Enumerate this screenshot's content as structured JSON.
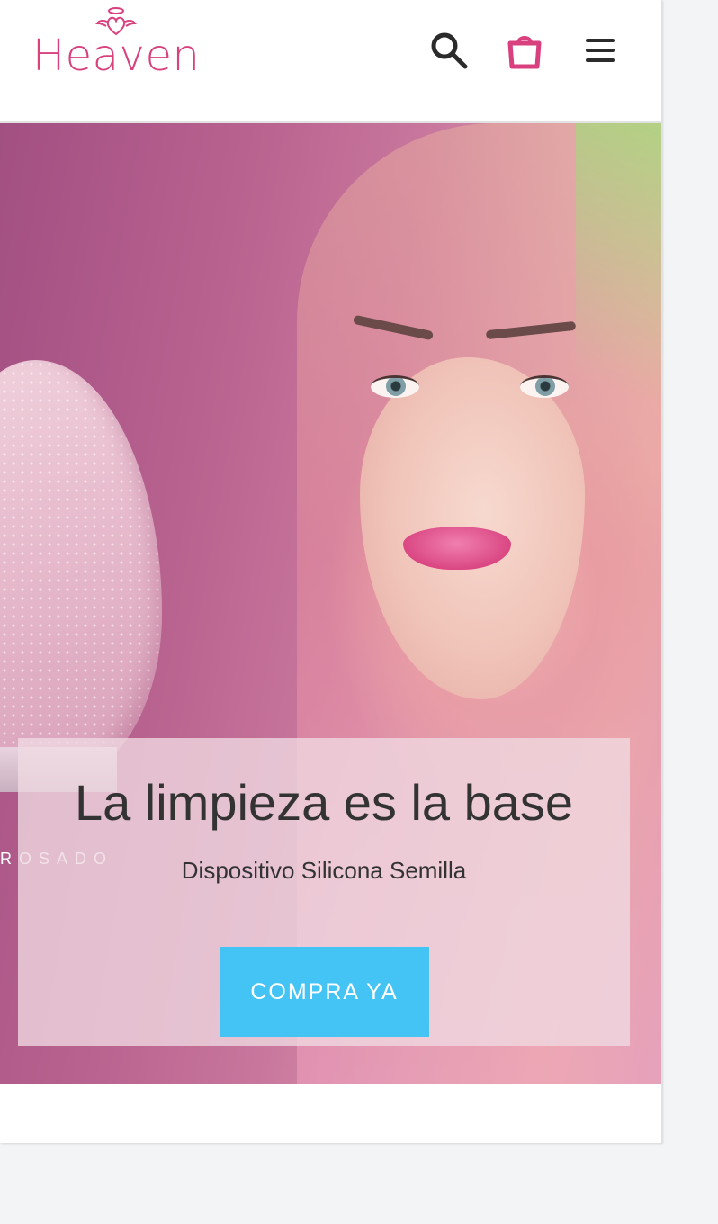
{
  "header": {
    "logo_text": "Heaven",
    "brand_color": "#d8407e",
    "icons": [
      "search-icon",
      "shopping-bag-icon",
      "hamburger-menu-icon"
    ]
  },
  "hero": {
    "product_tag": "ROSADO",
    "title": "La limpieza es la base",
    "subtitle": "Dispositivo Silicona Semilla",
    "cta_label": "COMPRA YA",
    "cta_color": "#44c3f5"
  }
}
